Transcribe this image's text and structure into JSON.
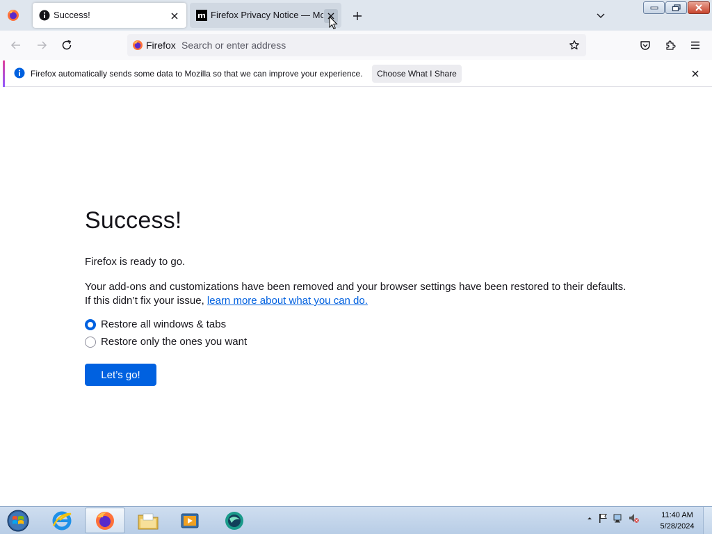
{
  "browser": {
    "tabs": [
      {
        "title": "Success!",
        "active": true,
        "favicon": "info-icon"
      },
      {
        "title": "Firefox Privacy Notice — Mozilla",
        "active": false,
        "favicon": "mozilla-m-icon"
      }
    ],
    "identity_label": "Firefox",
    "address_placeholder": "Search or enter address"
  },
  "notification": {
    "text": "Firefox automatically sends some data to Mozilla so that we can improve your experience.",
    "button_label": "Choose What I Share"
  },
  "page": {
    "heading": "Success!",
    "ready_text": "Firefox is ready to go.",
    "description_line1": "Your add-ons and customizations have been removed and your browser settings have been restored to their defaults.",
    "description_line2_prefix": "If this didn’t fix your issue,",
    "learn_more_link": "learn more about what you can do.",
    "options": [
      {
        "label": "Restore all windows & tabs",
        "selected": true
      },
      {
        "label": "Restore only the ones you want",
        "selected": false
      }
    ],
    "primary_button": "Let’s go!"
  },
  "taskbar": {
    "time": "11:40 AM",
    "date": "5/28/2024"
  },
  "colors": {
    "accent_blue": "#0061e0",
    "link": "#0060df",
    "tab_strip": "#dfe6ee"
  }
}
